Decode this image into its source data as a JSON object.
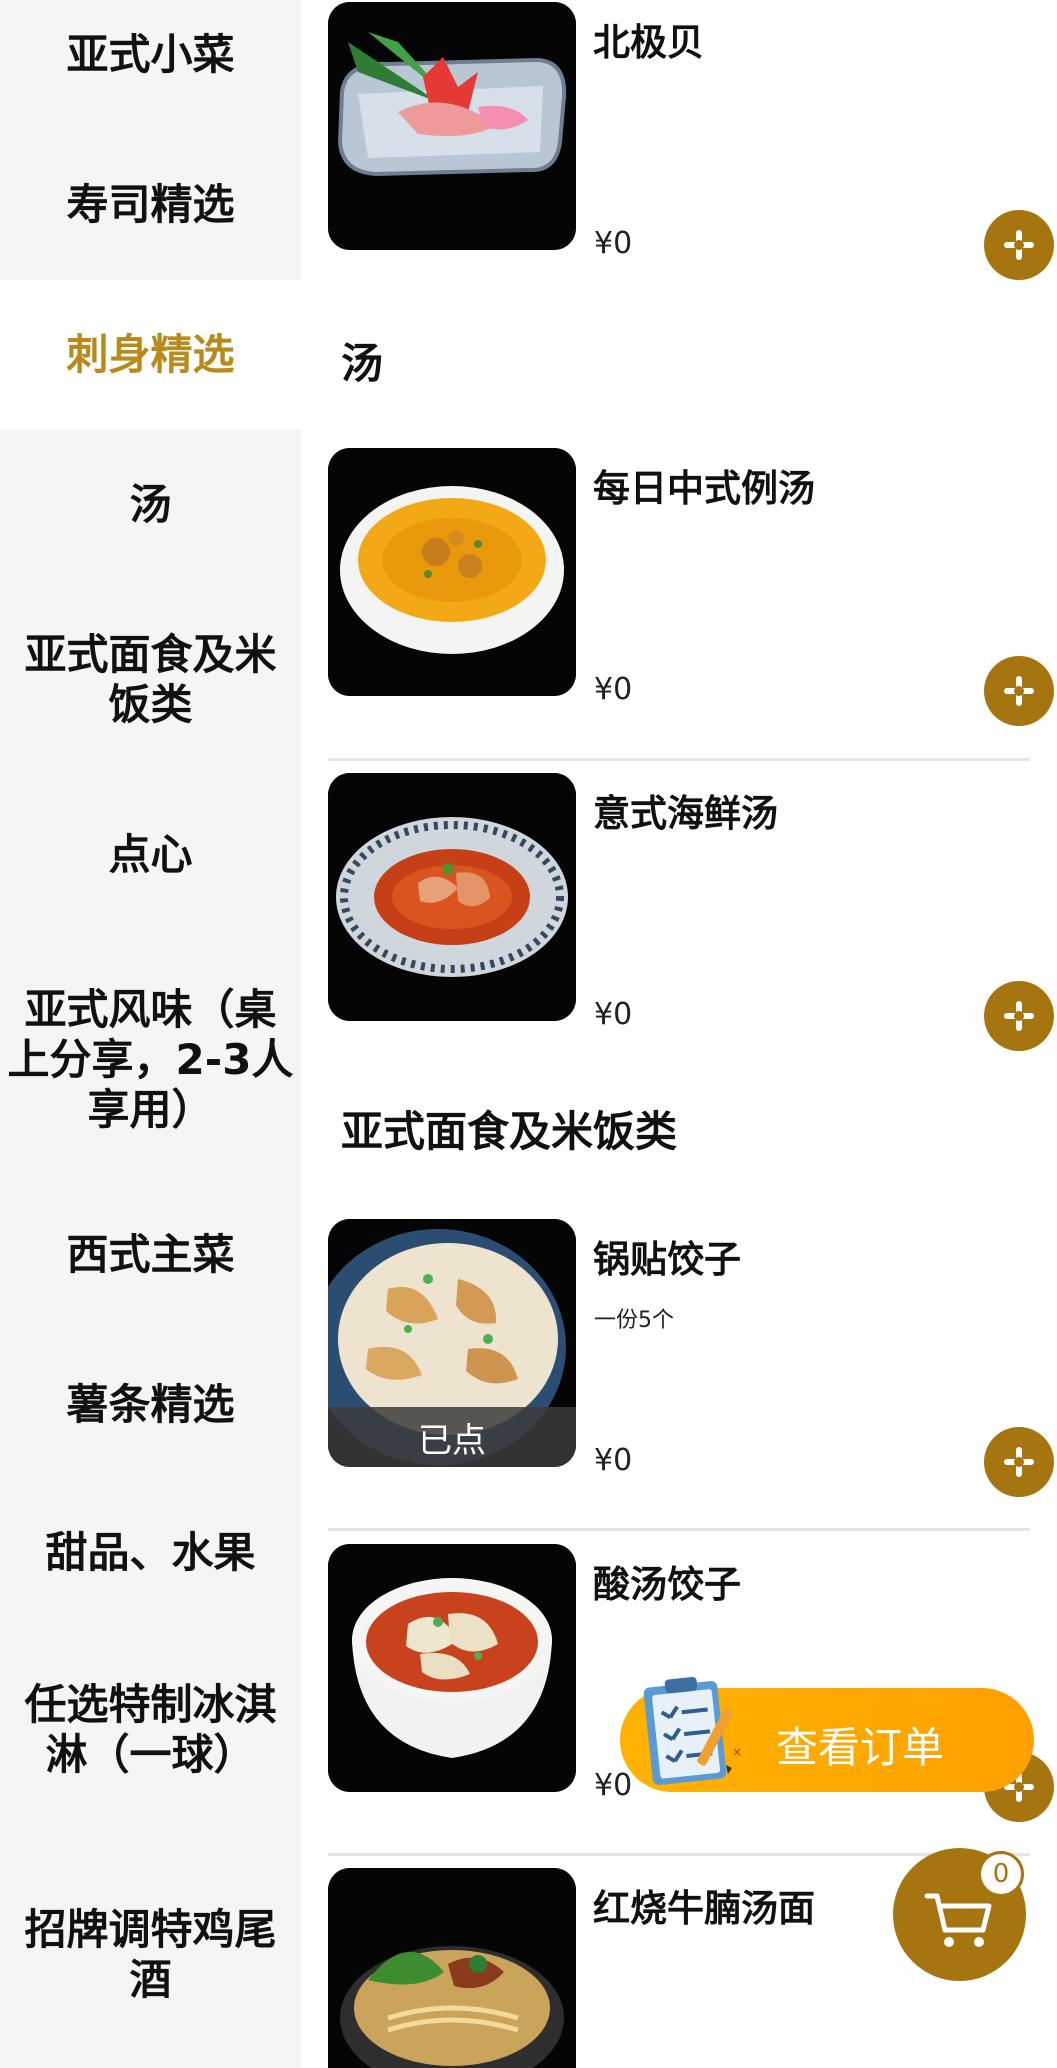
{
  "sidebar": {
    "categories": [
      {
        "label": "亚式小菜"
      },
      {
        "label": "寿司精选"
      },
      {
        "label": "刺身精选"
      },
      {
        "label": "汤"
      },
      {
        "label": "亚式面食及米饭类"
      },
      {
        "label": "点心"
      },
      {
        "label": "亚式风味（桌上分享，2-3人享用）"
      },
      {
        "label": "西式主菜"
      },
      {
        "label": "薯条精选"
      },
      {
        "label": "甜品、水果"
      },
      {
        "label": "任选特制冰淇淋（一球）"
      },
      {
        "label": "招牌调特鸡尾酒"
      }
    ],
    "active_index": 2,
    "accent_color": "#b88a1c"
  },
  "sections": {
    "sashimi_tail": {
      "items": [
        {
          "name": "北极贝",
          "price": "¥0"
        }
      ]
    },
    "soup": {
      "title": "汤",
      "items": [
        {
          "name": "每日中式例汤",
          "price": "¥0"
        },
        {
          "name": "意式海鲜汤",
          "price": "¥0"
        }
      ]
    },
    "noodles_rice": {
      "title": "亚式面食及米饭类",
      "items": [
        {
          "name": "锅贴饺子",
          "desc": "一份5个",
          "price": "¥0",
          "ordered_label": "已点"
        },
        {
          "name": "酸汤饺子",
          "price": "¥0"
        },
        {
          "name": "红烧牛腩汤面"
        }
      ]
    }
  },
  "order_button": {
    "label": "查看订单",
    "icon": "clipboard-checklist-icon"
  },
  "cart": {
    "count": "0",
    "icon": "cart-icon"
  },
  "colors": {
    "brand": "#a67510",
    "order_button": "#ffa800"
  }
}
